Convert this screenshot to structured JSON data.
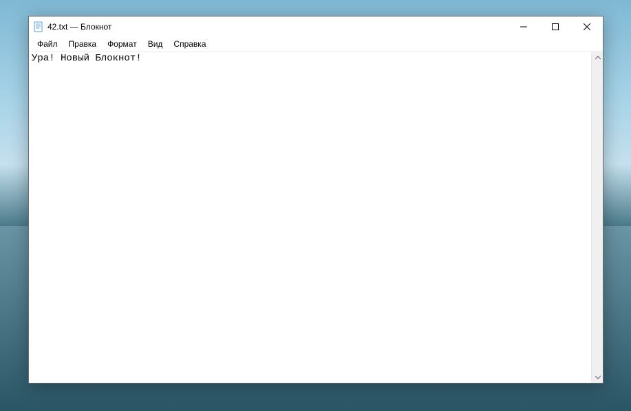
{
  "window": {
    "title": "42.txt — Блокнот"
  },
  "menu": {
    "items": [
      {
        "label": "Файл"
      },
      {
        "label": "Правка"
      },
      {
        "label": "Формат"
      },
      {
        "label": "Вид"
      },
      {
        "label": "Справка"
      }
    ]
  },
  "editor": {
    "content": "Ура! Новый Блокнот!"
  }
}
